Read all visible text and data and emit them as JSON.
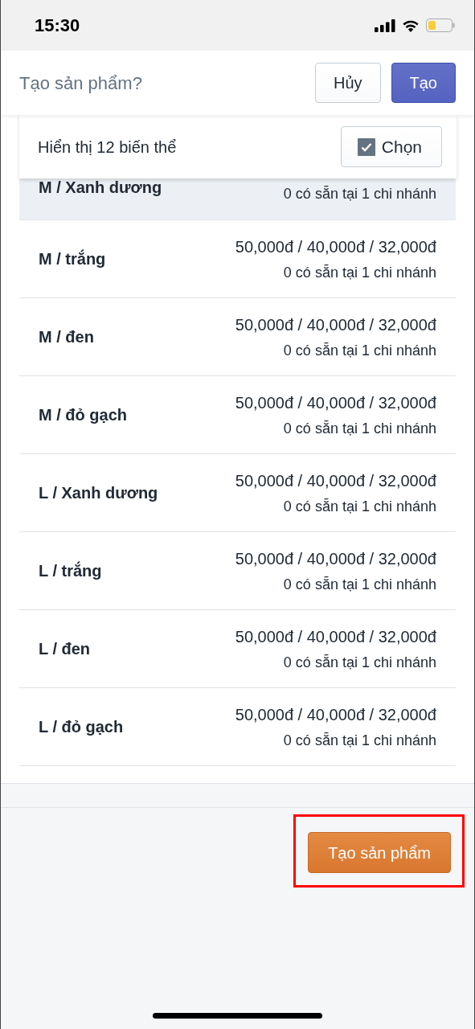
{
  "status_bar": {
    "time": "15:30"
  },
  "header": {
    "title": "Tạo sản phẩm?",
    "buttons": [
      {
        "label": "Hủy",
        "kind": "secondary"
      },
      {
        "label": "Tạo",
        "kind": "primary"
      }
    ]
  },
  "variant_bar": {
    "text": "Hiển thị 12 biến thể",
    "select_button": {
      "label": "Chọn",
      "checked": true
    }
  },
  "variants": [
    {
      "name": "M / Xanh dương",
      "stock": "0 có sẵn tại 1 chi nhánh",
      "selected": true
    },
    {
      "name": "M / trắng",
      "price": "50,000đ / 40,000đ / 32,000đ",
      "stock": "0 có sẵn tại 1 chi nhánh",
      "selected": false
    },
    {
      "name": "M / đen",
      "price": "50,000đ / 40,000đ / 32,000đ",
      "stock": "0 có sẵn tại 1 chi nhánh",
      "selected": false
    },
    {
      "name": "M / đỏ gạch",
      "price": "50,000đ / 40,000đ / 32,000đ",
      "stock": "0 có sẵn tại 1 chi nhánh",
      "selected": false
    },
    {
      "name": "L / Xanh dương",
      "price": "50,000đ / 40,000đ / 32,000đ",
      "stock": "0 có sẵn tại 1 chi nhánh",
      "selected": false
    },
    {
      "name": "L / trắng",
      "price": "50,000đ / 40,000đ / 32,000đ",
      "stock": "0 có sẵn tại 1 chi nhánh",
      "selected": false
    },
    {
      "name": "L / đen",
      "price": "50,000đ / 40,000đ / 32,000đ",
      "stock": "0 có sẵn tại 1 chi nhánh",
      "selected": false
    },
    {
      "name": "L / đỏ gạch",
      "price": "50,000đ / 40,000đ / 32,000đ",
      "stock": "0 có sẵn tại 1 chi nhánh",
      "selected": false
    }
  ],
  "footer": {
    "create_button": {
      "label": "Tạo sản phẩm",
      "highlighted": true
    }
  }
}
